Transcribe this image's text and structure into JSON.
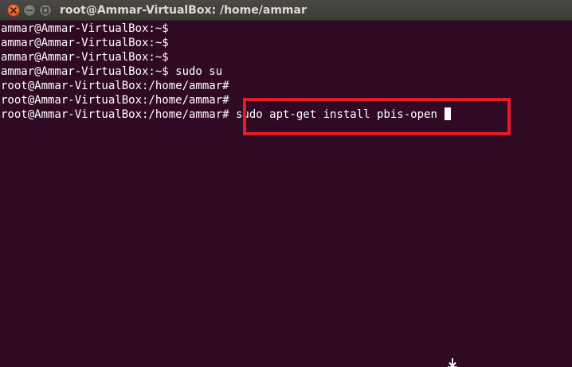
{
  "window": {
    "title": "root@Ammar-VirtualBox: /home/ammar",
    "buttons": {
      "close_icon": "close-icon",
      "minimize_icon": "minimize-icon",
      "maximize_icon": "maximize-icon"
    }
  },
  "terminal": {
    "lines": [
      {
        "prompt": "ammar@Ammar-VirtualBox:~$",
        "command": ""
      },
      {
        "prompt": "ammar@Ammar-VirtualBox:~$",
        "command": ""
      },
      {
        "prompt": "ammar@Ammar-VirtualBox:~$",
        "command": ""
      },
      {
        "prompt": "ammar@Ammar-VirtualBox:~$",
        "command": " sudo su"
      },
      {
        "prompt": "root@Ammar-VirtualBox:/home/ammar#",
        "command": ""
      },
      {
        "prompt": "root@Ammar-VirtualBox:/home/ammar#",
        "command": ""
      },
      {
        "prompt": "root@Ammar-VirtualBox:/home/ammar#",
        "command": " sudo apt-get install pbis-open "
      }
    ],
    "colors": {
      "background": "#300a24",
      "text": "#ffffff",
      "highlight": "#e31d25"
    }
  }
}
